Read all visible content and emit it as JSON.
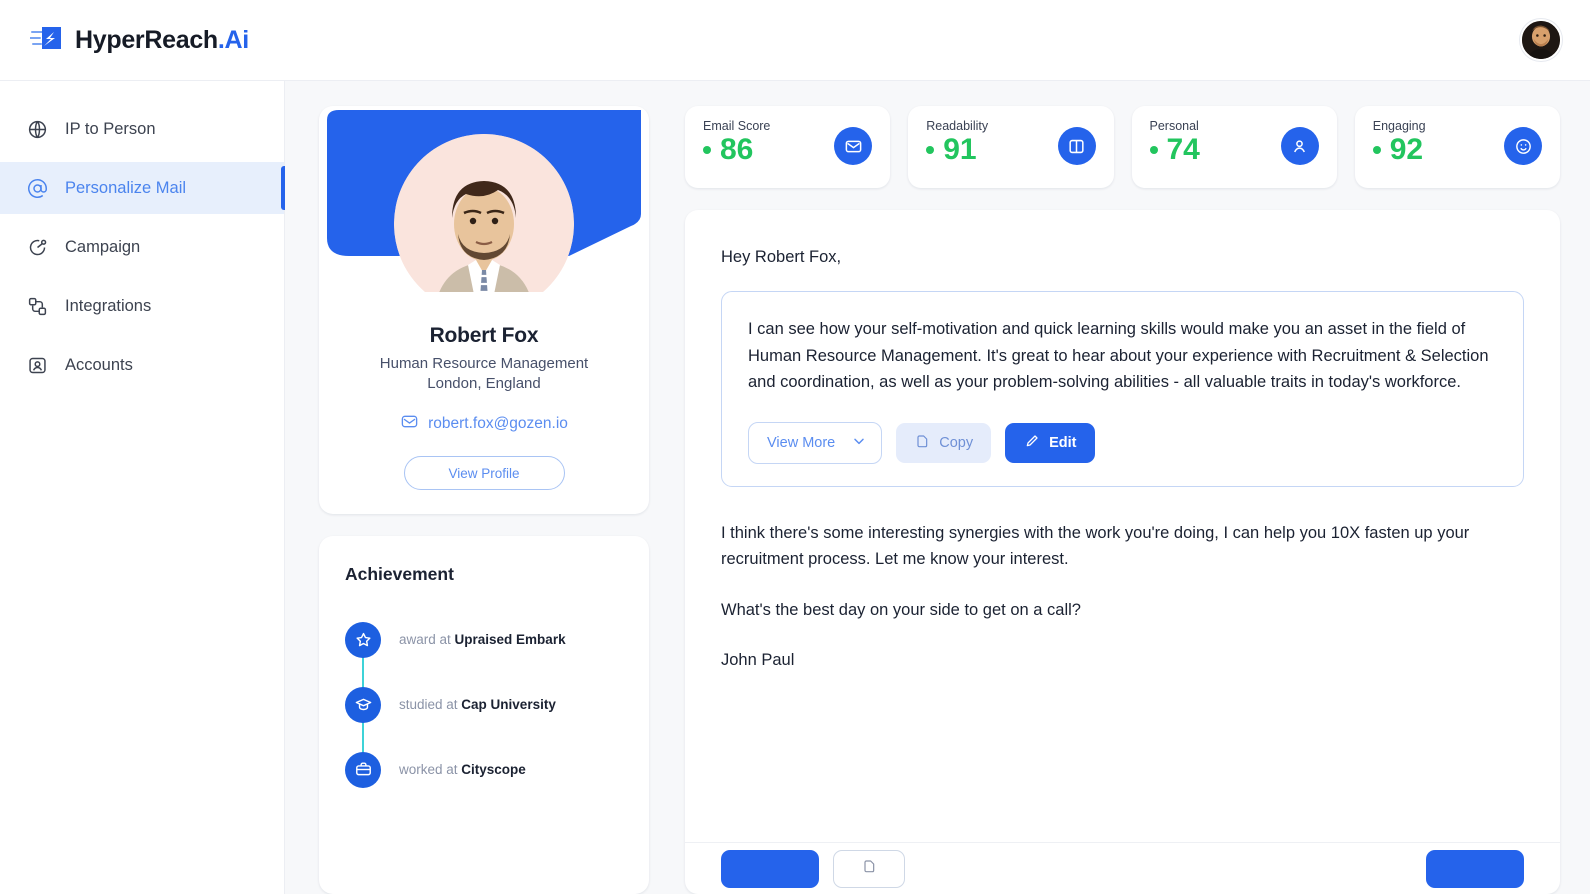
{
  "brand": {
    "name_main": "HyperReach",
    "name_suffix": ".Ai",
    "logo_icon": "hyperreach-logo-icon",
    "accent_color": "#2563eb"
  },
  "topbar": {
    "avatar_alt": "user-avatar"
  },
  "sidebar": {
    "items": [
      {
        "label": "IP to Person",
        "icon": "globe-icon",
        "active": false
      },
      {
        "label": "Personalize Mail",
        "icon": "at-sign-icon",
        "active": true
      },
      {
        "label": "Campaign",
        "icon": "campaign-pie-icon",
        "active": false
      },
      {
        "label": "Integrations",
        "icon": "integrations-icon",
        "active": false
      },
      {
        "label": "Accounts",
        "icon": "accounts-icon",
        "active": false
      }
    ]
  },
  "profile": {
    "name": "Robert Fox",
    "role": "Human Resource Management",
    "location": "London, England",
    "email": "robert.fox@gozen.io",
    "email_icon": "mail-icon",
    "view_profile_label": "View Profile"
  },
  "achievement": {
    "title": "Achievement",
    "items": [
      {
        "prefix": "award at ",
        "org": "Upraised Embark",
        "icon": "star-icon"
      },
      {
        "prefix": "studied at ",
        "org": "Cap University",
        "icon": "graduation-cap-icon"
      },
      {
        "prefix": "worked at ",
        "org": "Cityscope",
        "icon": "briefcase-icon"
      }
    ]
  },
  "scores": [
    {
      "label": "Email Score",
      "value": "86",
      "icon": "envelope-icon",
      "color": "#22c55e"
    },
    {
      "label": "Readability",
      "value": "91",
      "icon": "book-open-icon",
      "color": "#22c55e"
    },
    {
      "label": "Personal",
      "value": "74",
      "icon": "person-icon",
      "color": "#22c55e"
    },
    {
      "label": "Engaging",
      "value": "92",
      "icon": "smiley-icon",
      "color": "#22c55e"
    }
  ],
  "mail": {
    "greeting": "Hey Robert Fox,",
    "highlight_text": "I can see how your self-motivation and quick learning skills would make you an asset in the field of Human Resource Management. It's great to hear about your experience with Recruitment & Selection and coordination, as well as your problem-solving abilities - all valuable traits in today's workforce.",
    "actions": {
      "view_more": "View More",
      "view_more_icon": "chevron-down-icon",
      "copy": "Copy",
      "copy_icon": "copy-icon",
      "edit": "Edit",
      "edit_icon": "pencil-icon"
    },
    "paragraph_1": "I think there's some interesting synergies with the work you're doing, I can help you 10X fasten up your recruitment process. Let me know your interest.",
    "paragraph_2": "What's the best day on your side to get on a call?",
    "signature": "John Paul"
  },
  "footer": {
    "primary_label": "",
    "ghost_icon": "action-icon",
    "right_label": ""
  }
}
